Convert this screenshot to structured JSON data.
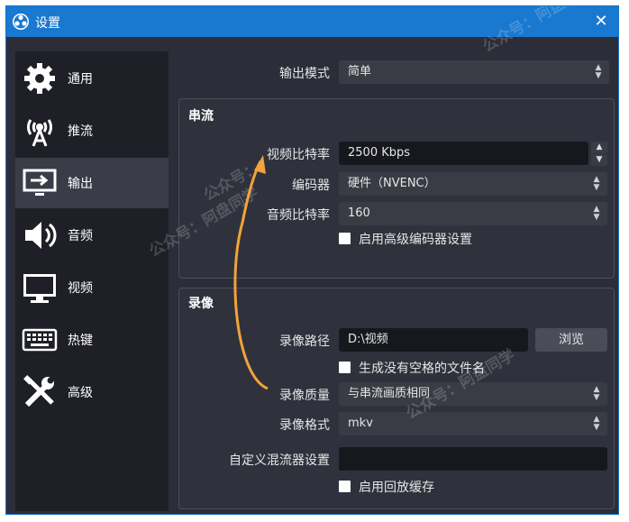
{
  "window": {
    "title": "设置",
    "close_symbol": "✕"
  },
  "sidebar": {
    "items": [
      {
        "label": "通用",
        "icon": "gear-icon"
      },
      {
        "label": "推流",
        "icon": "broadcast-antenna-icon"
      },
      {
        "label": "输出",
        "icon": "output-monitor-icon",
        "active": true
      },
      {
        "label": "音频",
        "icon": "speaker-icon"
      },
      {
        "label": "视频",
        "icon": "monitor-icon"
      },
      {
        "label": "热键",
        "icon": "keyboard-icon"
      },
      {
        "label": "高级",
        "icon": "tools-icon"
      }
    ]
  },
  "output_mode": {
    "label": "输出模式",
    "value": "简单"
  },
  "streaming": {
    "title": "串流",
    "video_bitrate_label": "视频比特率",
    "video_bitrate_value": "2500 Kbps",
    "encoder_label": "编码器",
    "encoder_value": "硬件（NVENC）",
    "audio_bitrate_label": "音频比特率",
    "audio_bitrate_value": "160",
    "advanced_encoder_checkbox": "启用高级编码器设置"
  },
  "recording": {
    "title": "录像",
    "path_label": "录像路径",
    "path_value": "D:\\视频",
    "browse_button": "浏览",
    "no_space_checkbox": "生成没有空格的文件名",
    "quality_label": "录像质量",
    "quality_value": "与串流画质相同",
    "format_label": "录像格式",
    "format_value": "mkv",
    "muxer_label": "自定义混流器设置",
    "muxer_value": "",
    "replay_buffer_checkbox": "启用回放缓存"
  },
  "watermarks": [
    "公众号：阿盘同学",
    "公众号：阿盘同学",
    "公众号：阿盘同学",
    "公众号："
  ],
  "colors": {
    "titlebar": "#1979d0",
    "accent_arrow": "#f2a33a",
    "background": "#2b2e38"
  }
}
